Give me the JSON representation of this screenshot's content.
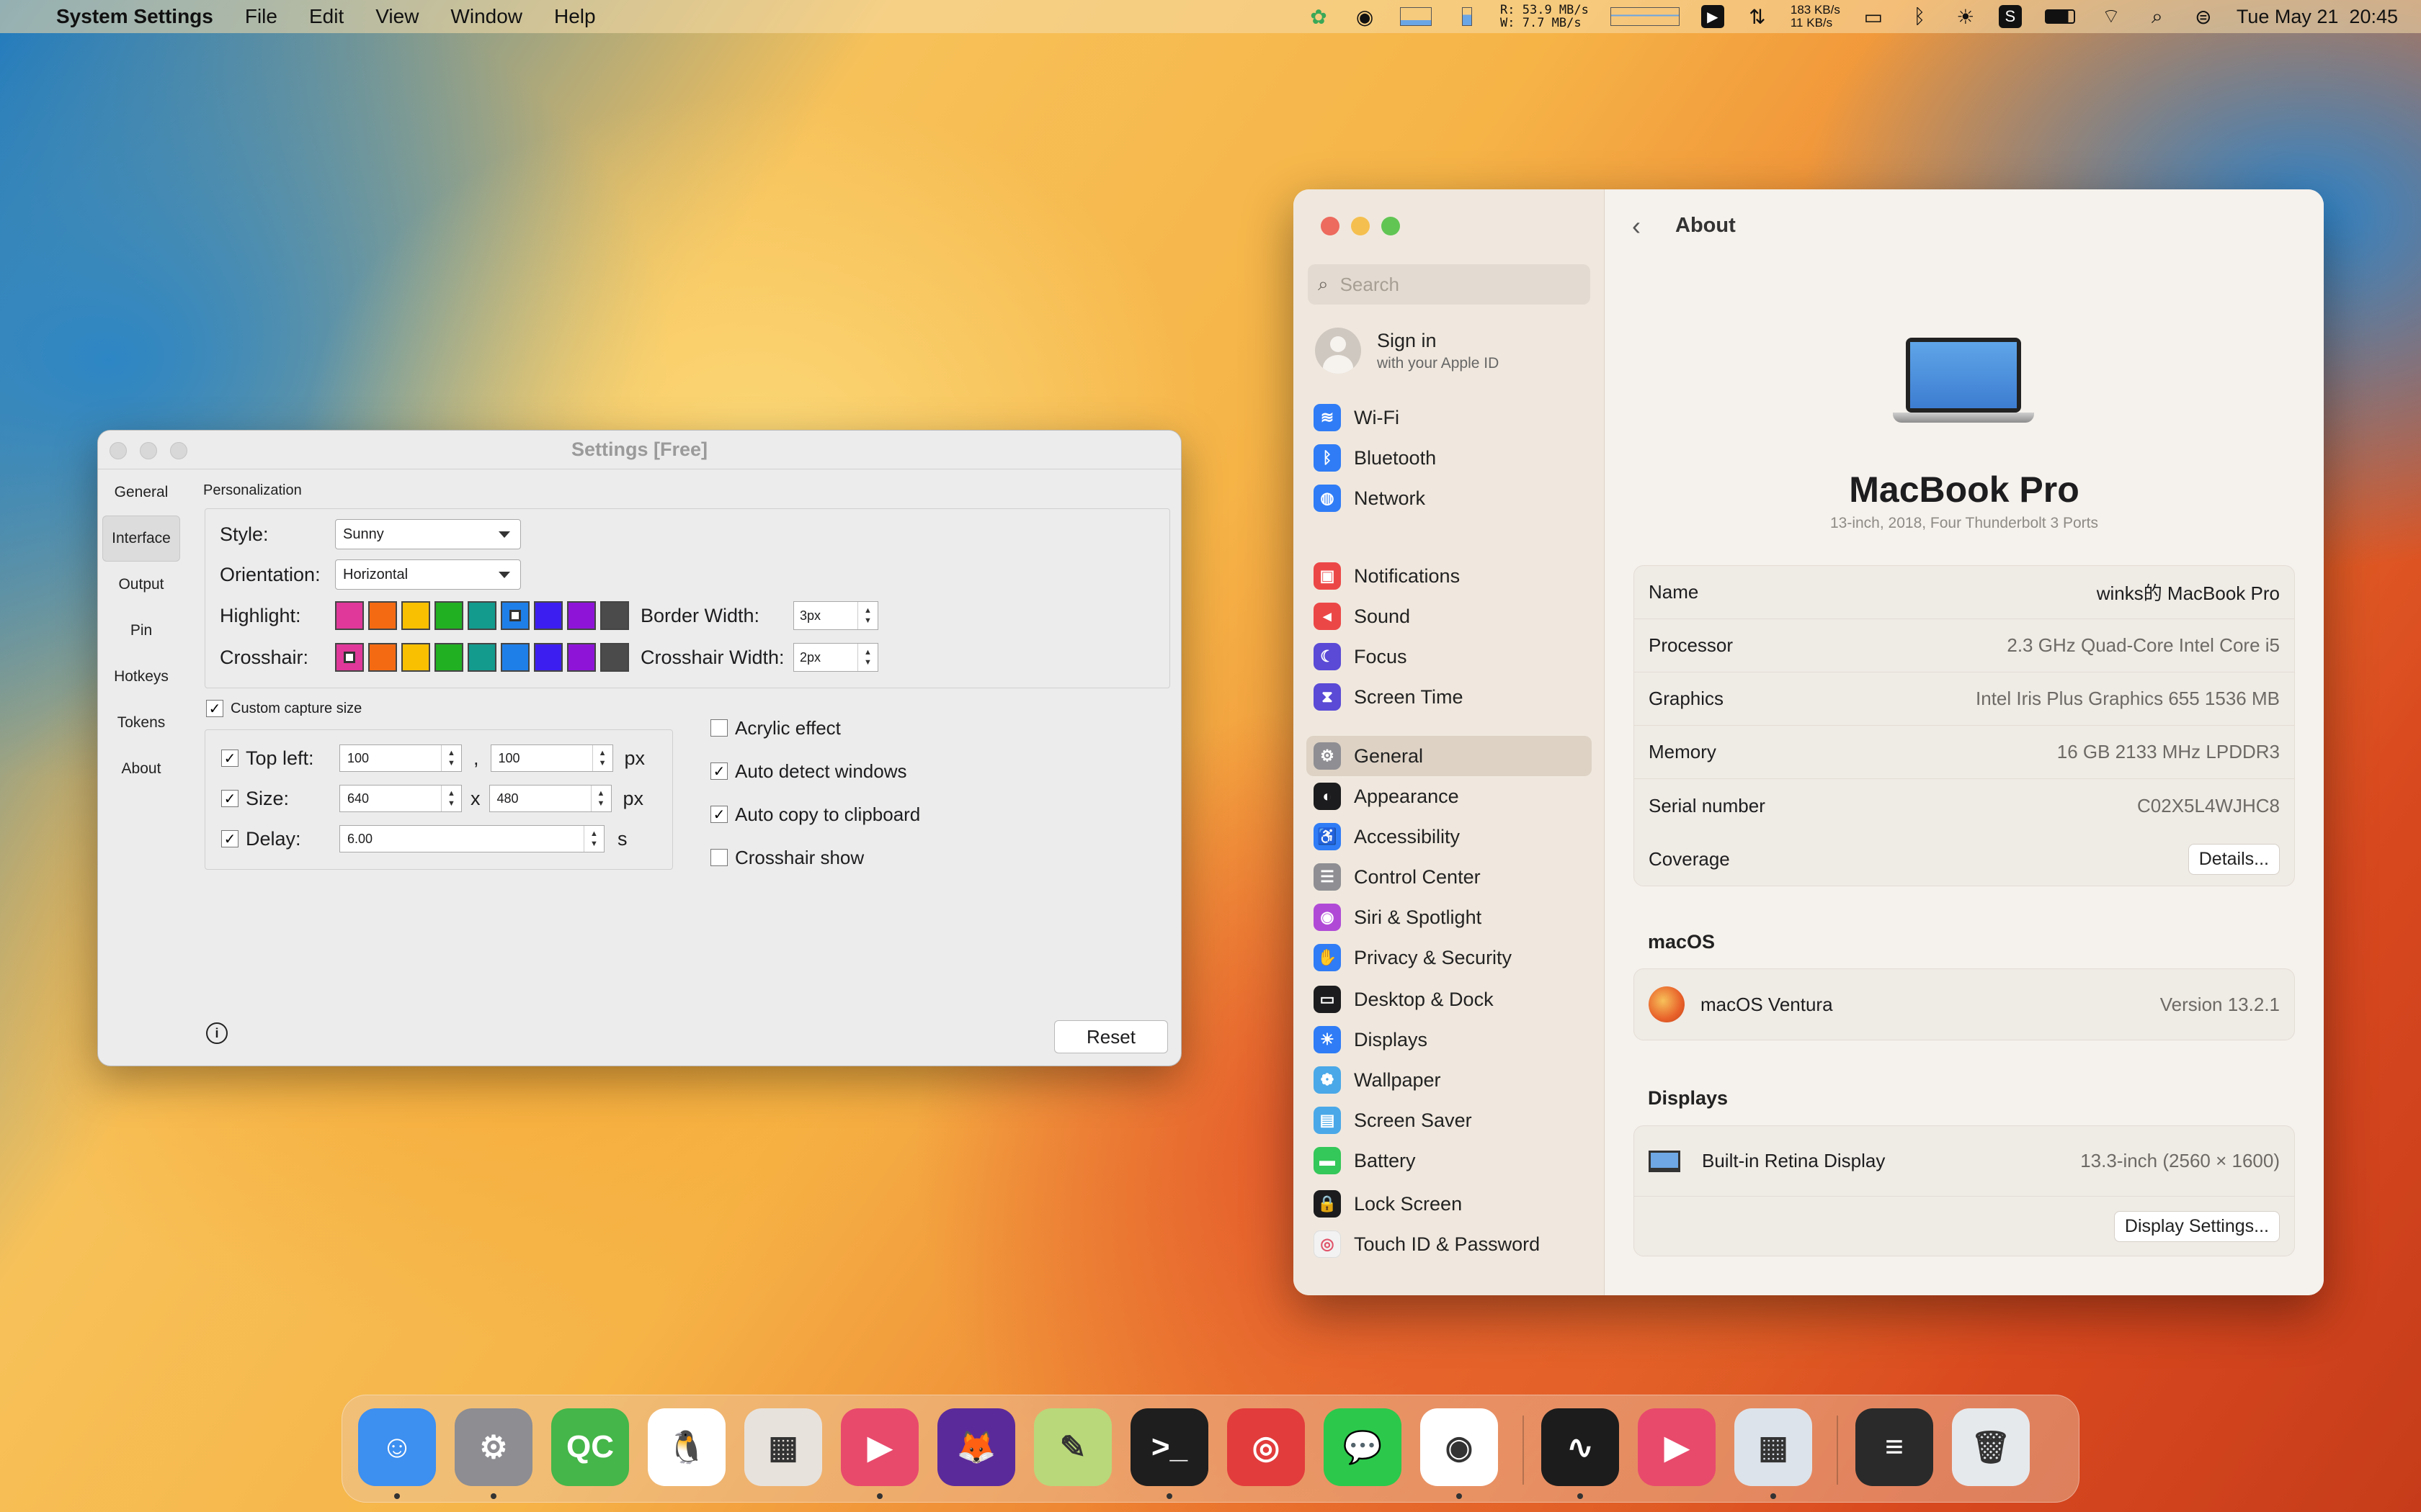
{
  "menubar": {
    "app": "System Settings",
    "items": [
      "File",
      "Edit",
      "View",
      "Window",
      "Help"
    ],
    "net_r": "R:  53.9 MB/s",
    "net_w": "W:    7.7 MB/s",
    "speed_up": "183 KB/s",
    "speed_down": "11 KB/s",
    "datetime": "Tue May 21  20:45"
  },
  "snip": {
    "title": "Settings [Free]",
    "tabs": [
      "General",
      "Interface",
      "Output",
      "Pin",
      "Hotkeys",
      "Tokens",
      "About"
    ],
    "section": "Personalization",
    "style_label": "Style:",
    "style_value": "Sunny",
    "orientation_label": "Orientation:",
    "orientation_value": "Horizontal",
    "highlight_label": "Highlight:",
    "crosshair_label": "Crosshair:",
    "swatches": [
      "#e0389a",
      "#f46a12",
      "#f8c000",
      "#22b023",
      "#139b8e",
      "#1f7fe8",
      "#3c1ef0",
      "#8e14d8",
      "#4b4b4b"
    ],
    "border_width_label": "Border Width:",
    "border_width_value": "3px",
    "crosshair_width_label": "Crosshair Width:",
    "crosshair_width_value": "2px",
    "custom_capture": "Custom capture size",
    "topleft_label": "Top left:",
    "topleft_x": "100",
    "topleft_y": "100",
    "comma": ",",
    "px": "px",
    "size_label": "Size:",
    "size_w": "640",
    "size_h": "480",
    "x": "x",
    "delay_label": "Delay:",
    "delay_value": "6.00",
    "s": "s",
    "acrylic": "Acrylic effect",
    "auto_detect": "Auto detect windows",
    "auto_copy": "Auto copy to clipboard",
    "crosshair_show": "Crosshair show",
    "reset": "Reset"
  },
  "sys": {
    "search_placeholder": "Search",
    "signin": "Sign in",
    "signin_sub": "with your Apple ID",
    "nav_groups": [
      [
        {
          "label": "Wi-Fi",
          "color": "#2f7cf6",
          "icon": "≋"
        },
        {
          "label": "Bluetooth",
          "color": "#2f7cf6",
          "icon": "ᛒ"
        },
        {
          "label": "Network",
          "color": "#2f7cf6",
          "icon": "◍"
        }
      ],
      [
        {
          "label": "Notifications",
          "color": "#ec4747",
          "icon": "▣"
        },
        {
          "label": "Sound",
          "color": "#ec4747",
          "icon": "◂"
        },
        {
          "label": "Focus",
          "color": "#5a4ad6",
          "icon": "☾"
        },
        {
          "label": "Screen Time",
          "color": "#5a4ad6",
          "icon": "⧗"
        }
      ],
      [
        {
          "label": "General",
          "color": "#8e8e93",
          "icon": "⚙"
        },
        {
          "label": "Appearance",
          "color": "#1c1c1e",
          "icon": "◐"
        },
        {
          "label": "Accessibility",
          "color": "#2f7cf6",
          "icon": "♿"
        },
        {
          "label": "Control Center",
          "color": "#8e8e93",
          "icon": "☰"
        },
        {
          "label": "Siri & Spotlight",
          "color": "#b04ad6",
          "icon": "◉"
        },
        {
          "label": "Privacy & Security",
          "color": "#2f7cf6",
          "icon": "✋"
        }
      ],
      [
        {
          "label": "Desktop & Dock",
          "color": "#1c1c1e",
          "icon": "▭"
        },
        {
          "label": "Displays",
          "color": "#2f7cf6",
          "icon": "☀"
        },
        {
          "label": "Wallpaper",
          "color": "#4aa8e8",
          "icon": "❁"
        },
        {
          "label": "Screen Saver",
          "color": "#4aa8e8",
          "icon": "▤"
        },
        {
          "label": "Battery",
          "color": "#34c759",
          "icon": "▬"
        }
      ],
      [
        {
          "label": "Lock Screen",
          "color": "#1c1c1e",
          "icon": "🔒"
        },
        {
          "label": "Touch ID & Password",
          "color": "#f2f2f2",
          "icon": "◎"
        }
      ]
    ],
    "page_title": "About",
    "model": "MacBook Pro",
    "model_sub": "13-inch, 2018, Four Thunderbolt 3 Ports",
    "specs": [
      {
        "k": "Name",
        "v": "winks的 MacBook Pro"
      },
      {
        "k": "Processor",
        "v": "2.3 GHz Quad-Core Intel Core i5"
      },
      {
        "k": "Graphics",
        "v": "Intel Iris Plus Graphics 655 1536 MB"
      },
      {
        "k": "Memory",
        "v": "16 GB 2133 MHz LPDDR3"
      },
      {
        "k": "Serial number",
        "v": "C02X5L4WJHC8"
      }
    ],
    "coverage": "Coverage",
    "details": "Details...",
    "macos_head": "macOS",
    "macos_name": "macOS Ventura",
    "macos_ver": "Version 13.2.1",
    "displays_head": "Displays",
    "display_name": "Built-in Retina Display",
    "display_size": "13.3-inch (2560 × 1600)",
    "display_settings": "Display Settings..."
  },
  "dock": [
    {
      "name": "finder",
      "color": "#3d8ff0",
      "glyph": "☺"
    },
    {
      "name": "system-settings",
      "color": "#8d8d92",
      "glyph": "⚙"
    },
    {
      "name": "qc",
      "color": "#45b649",
      "glyph": "QC"
    },
    {
      "name": "qq",
      "color": "#ffffff",
      "glyph": "🐧"
    },
    {
      "name": "launchpad",
      "color": "#e7e2dc",
      "glyph": "▦"
    },
    {
      "name": "snipaste",
      "color": "#e84a6c",
      "glyph": "▶"
    },
    {
      "name": "firefox",
      "color": "#5b2a9a",
      "glyph": "🦊"
    },
    {
      "name": "script-editor",
      "color": "#b9d87a",
      "glyph": "✎"
    },
    {
      "name": "terminal",
      "color": "#1e1e1e",
      "glyph": ">_"
    },
    {
      "name": "netease-music",
      "color": "#e23c3c",
      "glyph": "◎"
    },
    {
      "name": "wechat",
      "color": "#2cc84c",
      "glyph": "💬"
    },
    {
      "name": "chrome",
      "color": "#ffffff",
      "glyph": "◉"
    },
    {
      "name": "activity-monitor",
      "color": "#1c1c1c",
      "glyph": "∿"
    },
    {
      "name": "snipaste-2",
      "color": "#e84a6c",
      "glyph": "▶"
    },
    {
      "name": "preview-blank",
      "color": "#dde3ea",
      "glyph": "▦"
    },
    {
      "name": "terminal-window",
      "color": "#2a2a2a",
      "glyph": "≡"
    },
    {
      "name": "trash",
      "color": "#e6e9ec",
      "glyph": "🗑"
    }
  ]
}
